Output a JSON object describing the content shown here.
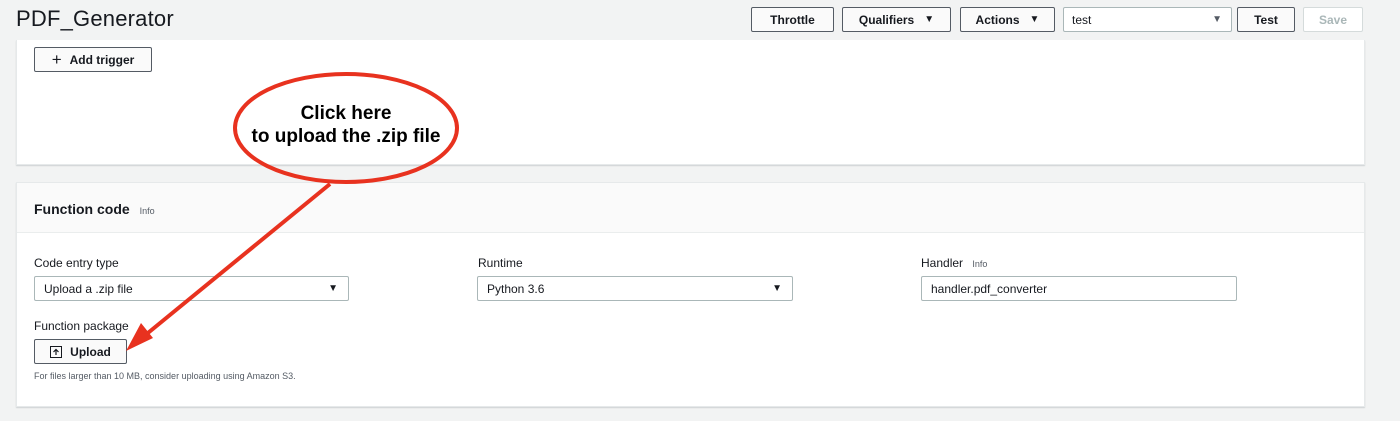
{
  "header": {
    "title": "PDF_Generator",
    "throttle_label": "Throttle",
    "qualifiers_label": "Qualifiers",
    "actions_label": "Actions",
    "test_event_value": "test",
    "test_label": "Test",
    "save_label": "Save",
    "caret_icon": "caret-down-icon"
  },
  "triggers": {
    "add_trigger_label": "Add trigger",
    "add_icon": "plus-icon"
  },
  "annotation": {
    "line1": "Click here",
    "line2": "to upload the .zip file",
    "color": "#e8321f"
  },
  "function_code": {
    "title": "Function code",
    "info_label": "Info",
    "code_entry_type": {
      "label": "Code entry type",
      "value": "Upload a .zip file"
    },
    "runtime": {
      "label": "Runtime",
      "value": "Python 3.6"
    },
    "handler": {
      "label": "Handler",
      "info_label": "Info",
      "value": "handler.pdf_converter"
    },
    "function_package": {
      "label": "Function package",
      "upload_label": "Upload",
      "upload_icon": "upload-icon",
      "hint": "For files larger than 10 MB, consider uploading using Amazon S3."
    }
  }
}
